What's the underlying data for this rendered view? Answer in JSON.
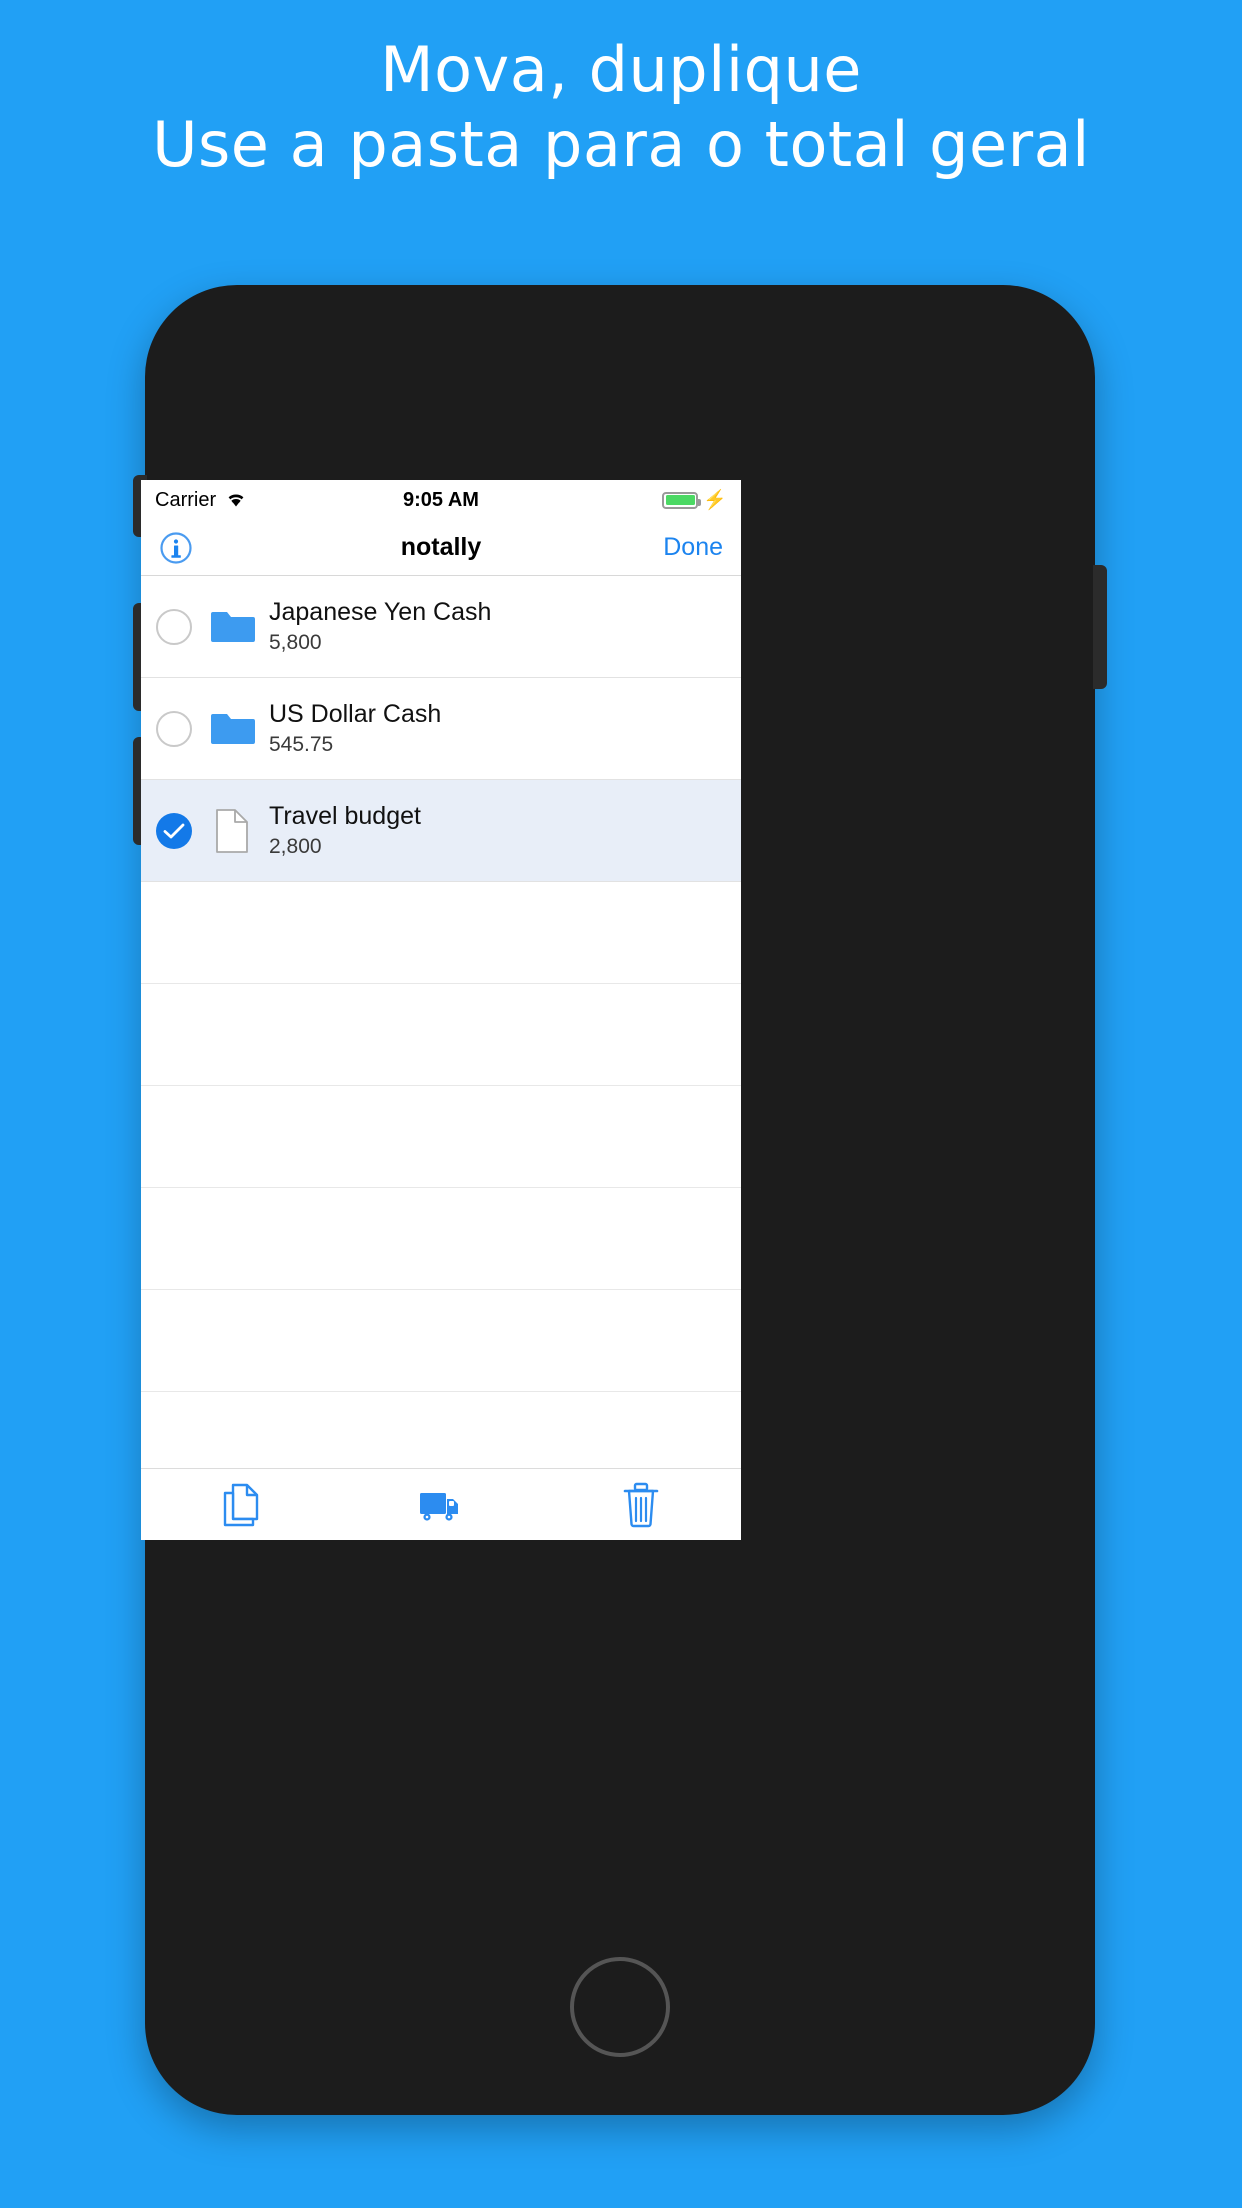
{
  "promo": {
    "line1": "Mova, duplique",
    "line2": "Use a pasta para o total geral",
    "background_color": "#21a0f5",
    "text_color": "#ffffff"
  },
  "statusbar": {
    "carrier": "Carrier",
    "wifi_icon": "wifi-icon",
    "time": "9:05 AM",
    "battery_icon": "battery-icon",
    "charging_icon": "lightning-bolt-icon",
    "battery_color": "#4cd964"
  },
  "navbar": {
    "info_icon": "info-circle-icon",
    "title": "notally",
    "done_label": "Done",
    "accent_color": "#1c84ef"
  },
  "list": {
    "rows": [
      {
        "checked": false,
        "icon": "folder-icon",
        "title": "Japanese Yen Cash",
        "subtitle": "5,800"
      },
      {
        "checked": false,
        "icon": "folder-icon",
        "title": "US Dollar Cash",
        "subtitle": "545.75"
      },
      {
        "checked": true,
        "icon": "document-icon",
        "title": "Travel budget",
        "subtitle": "2,800"
      }
    ],
    "empty_row_count": 11,
    "selected_row_background": "#e8eef8",
    "folder_color": "#3d9bf0"
  },
  "toolbar": {
    "duplicate_label": "Duplicate",
    "move_label": "Move",
    "delete_label": "Delete",
    "icons": [
      "duplicate-documents-icon",
      "moving-truck-icon",
      "trash-can-icon"
    ],
    "icon_color": "#2c8cf0"
  },
  "device": {
    "body_color": "#1c1c1c",
    "home_button": "home-button"
  }
}
